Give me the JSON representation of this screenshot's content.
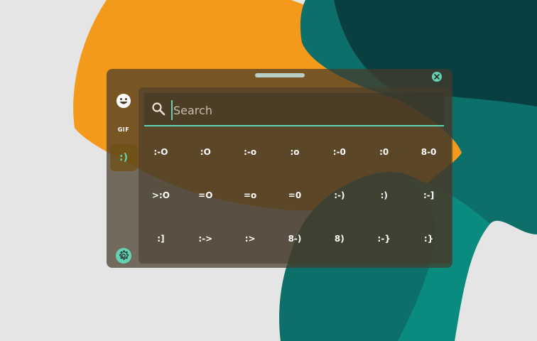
{
  "search": {
    "placeholder": "Search"
  },
  "sidebar": {
    "items": [
      {
        "icon": "smiley-icon"
      },
      {
        "label": "GIF"
      },
      {
        "label": ":)"
      },
      {
        "icon": "gear-icon"
      }
    ]
  },
  "emoticons": [
    ":-O",
    ":O",
    ":-o",
    ":o",
    ":-0",
    ":0",
    "8-0",
    ">:O",
    "=O",
    "=o",
    "=0",
    ":-)",
    ":)",
    ":-]",
    ":]",
    ":->",
    ":>",
    "8-)",
    "8)",
    ":-}",
    ":}"
  ],
  "colors": {
    "accent": "#63d4b3",
    "panel": "#463a2a",
    "active": "#6e5014"
  }
}
